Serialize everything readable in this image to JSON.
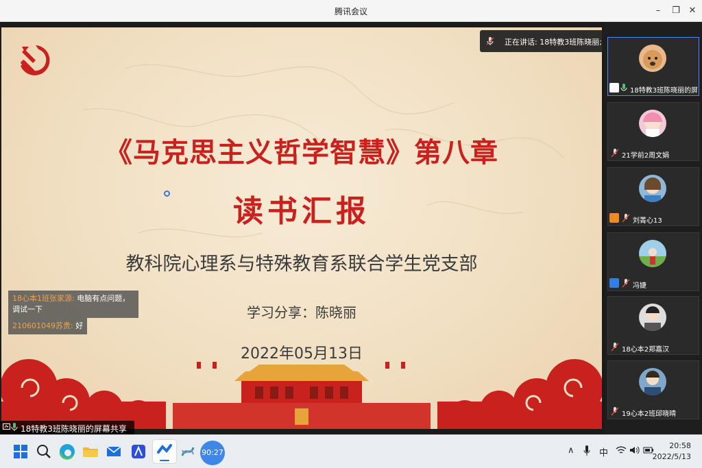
{
  "window": {
    "title": "腾讯会议",
    "minimize": "–",
    "restore": "❐",
    "close": "✕"
  },
  "slide": {
    "title_line1": "《马克思主义哲学智慧》第八章",
    "title_line2": "读书汇报",
    "org": "教科院心理系与特殊教育系联合学生党支部",
    "presenter": "学习分享：陈晓丽",
    "date": "2022年05月13日"
  },
  "speaking": {
    "text": "正在讲话: 18特教3班陈晓丽;"
  },
  "chat": [
    {
      "name": "18心本1班张家源:",
      "text": " 电脑有点问题，调试一下"
    },
    {
      "name": "210601049苏贵:",
      "text": " 好"
    }
  ],
  "share_bar": {
    "label": "18特教3班陈晓丽的屏幕共享"
  },
  "participants": [
    {
      "name": "18特教3班陈晓丽的屏...",
      "badge": "share",
      "badge_color": "#ffffff"
    },
    {
      "name": "21学前2周文娟",
      "badge": "",
      "badge_color": ""
    },
    {
      "name": "刘菁心13",
      "badge": "person",
      "badge_color": "#f08a24"
    },
    {
      "name": "冯婕",
      "badge": "person",
      "badge_color": "#2f7fe6"
    },
    {
      "name": "18心本2郑嘉汉",
      "badge": "",
      "badge_color": ""
    },
    {
      "name": "19心本2班邱晓晴",
      "badge": "",
      "badge_color": ""
    }
  ],
  "taskbar": {
    "weather": "90:27",
    "tray_caret": "∧",
    "ime": "中",
    "time": "20:58",
    "date": "2022/5/13"
  }
}
